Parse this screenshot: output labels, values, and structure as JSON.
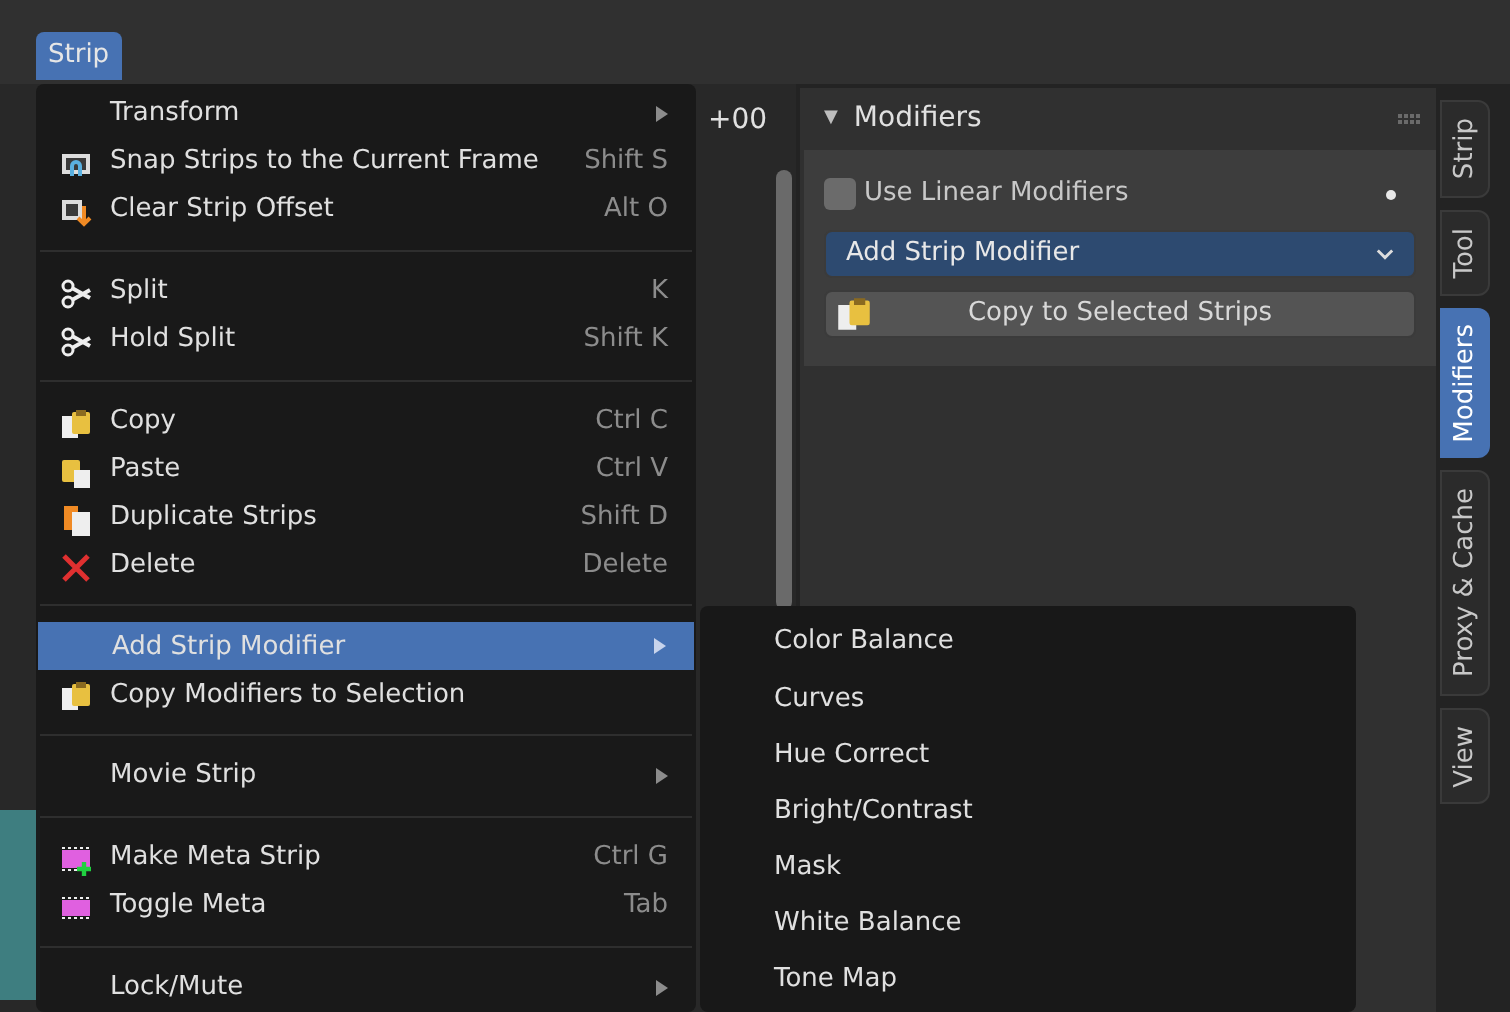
{
  "header_menu": {
    "label": "Strip",
    "selected": true
  },
  "timeline": {
    "ruler_text": "+00"
  },
  "strip_menu": {
    "sections": [
      {
        "items": [
          {
            "label": "Transform",
            "submenu": true,
            "selected": false
          },
          {
            "label": "Snap Strips to the Current Frame",
            "shortcut": "Shift S",
            "submenu": false,
            "selected": false
          },
          {
            "label": "Clear Strip Offset",
            "shortcut": "Alt O",
            "submenu": false,
            "selected": false
          }
        ]
      },
      {
        "items": [
          {
            "label": "Split",
            "shortcut": "K",
            "submenu": false,
            "selected": false
          },
          {
            "label": "Hold Split",
            "shortcut": "Shift K",
            "submenu": false,
            "selected": false
          }
        ]
      },
      {
        "items": [
          {
            "label": "Copy",
            "shortcut": "Ctrl C",
            "submenu": false,
            "selected": false
          },
          {
            "label": "Paste",
            "shortcut": "Ctrl V",
            "submenu": false,
            "selected": false
          },
          {
            "label": "Duplicate Strips",
            "shortcut": "Shift D",
            "submenu": false,
            "selected": false
          },
          {
            "label": "Delete",
            "shortcut": "Delete",
            "submenu": false,
            "selected": false
          }
        ]
      },
      {
        "items": [
          {
            "label": "Add Strip Modifier",
            "submenu": true,
            "selected": true
          },
          {
            "label": "Copy Modifiers to Selection",
            "submenu": false,
            "selected": false
          }
        ]
      },
      {
        "items": [
          {
            "label": "Movie Strip",
            "submenu": true,
            "selected": false
          }
        ]
      },
      {
        "items": [
          {
            "label": "Make Meta Strip",
            "shortcut": "Ctrl G",
            "submenu": false,
            "selected": false
          },
          {
            "label": "Toggle Meta",
            "shortcut": "Tab",
            "submenu": false,
            "selected": false
          }
        ]
      },
      {
        "items": [
          {
            "label": "Lock/Mute",
            "submenu": true,
            "selected": false
          }
        ]
      }
    ]
  },
  "submenu": {
    "items": [
      {
        "label": "Color Balance"
      },
      {
        "label": "Curves"
      },
      {
        "label": "Hue Correct"
      },
      {
        "label": "Bright/Contrast"
      },
      {
        "label": "Mask"
      },
      {
        "label": "White Balance"
      },
      {
        "label": "Tone Map"
      }
    ]
  },
  "modifiers_panel": {
    "title": "Modifiers",
    "expanded": true,
    "expander": "▼",
    "use_linear_modifiers": {
      "label": "Use Linear Modifiers",
      "checked": false
    },
    "add_dropdown": {
      "value": "Add Strip Modifier"
    },
    "copy_button": {
      "label": "Copy to Selected Strips"
    }
  },
  "sidebar_tabs": [
    {
      "label": "Strip",
      "selected": false
    },
    {
      "label": "Tool",
      "selected": false
    },
    {
      "label": "Modifiers",
      "selected": true
    },
    {
      "label": "Proxy & Cache",
      "selected": false
    },
    {
      "label": "View",
      "selected": false
    }
  ]
}
